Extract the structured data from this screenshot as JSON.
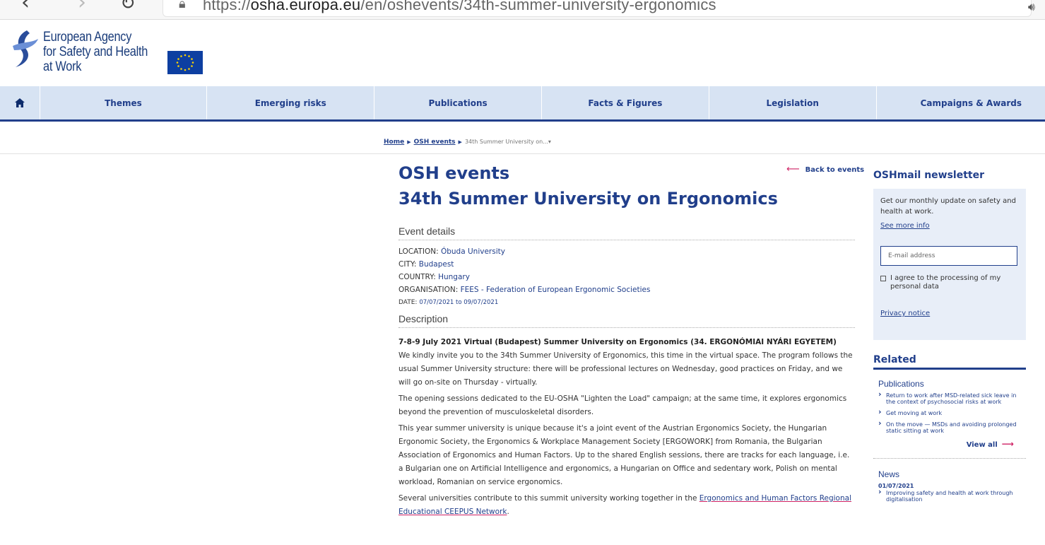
{
  "browser": {
    "back_icon": "‹",
    "forward_icon": "›",
    "reload_icon": "↻",
    "url_prefix": "https://",
    "url_domain": "osha.europa.eu",
    "url_path": "/en/oshevents/34th-summer-university-ergonomics"
  },
  "header": {
    "logo_line1": "European Agency",
    "logo_line2": "for Safety and Health",
    "logo_line3": "at Work"
  },
  "nav": {
    "items": [
      "Themes",
      "Emerging risks",
      "Publications",
      "Facts & Figures",
      "Legislation",
      "Campaigns & Awards"
    ]
  },
  "breadcrumb": {
    "home": "Home",
    "events": "OSH events",
    "current": "34th Summer University on...▾"
  },
  "main": {
    "back_label": "Back to events",
    "section": "OSH events",
    "title": "34th Summer University on Ergonomics",
    "details_heading": "Event details",
    "details": [
      {
        "label": "LOCATION: ",
        "value": "Óbuda University"
      },
      {
        "label": "CITY: ",
        "value": "Budapest"
      },
      {
        "label": "COUNTRY: ",
        "value": "Hungary"
      },
      {
        "label": "ORGANISATION: ",
        "value": "FEES - Federation of European Ergonomic Societies"
      },
      {
        "label": "DATE: ",
        "value": "07/07/2021 to 09/07/2021"
      }
    ],
    "description_heading": "Description",
    "desc_title": "7-8-9 July 2021 Virtual (Budapest) Summer University on Ergonomics (34. ERGONÓMIAI NYÁRI EGYETEM)",
    "paragraphs": [
      "We kindly invite you to the 34th Summer University of Ergonomics, this time in the virtual space. The program follows the usual Summer University structure: there will be professional lectures on Wednesday, good practices on Friday, and we will go on-site on Thursday - virtually.",
      "The opening sessions dedicated to the EU-OSHA \"Lighten the Load\" campaign; at the same time, it explores ergonomics beyond the prevention of musculoskeletal disorders.",
      "This year summer university is unique because it's a joint event of the Austrian Ergonomics Society, the Hungarian Ergonomic Society, the Ergonomics & Workplace Management Society [ERGOWORK] from Romania, the Bulgarian Association of Ergonomics and Human Factors. Up to the shared English sessions, there are tracks for each language, i.e. a Bulgarian one on Artificial Intelligence and ergonomics, a Hungarian on Office and sedentary work, Polish on mental workload, Romanian on service ergonomics."
    ],
    "last_para_prefix": "Several universities contribute to this summit university working together in the ",
    "last_para_link": "Ergonomics and Human Factors Regional Educational CEEPUS Network",
    "last_para_suffix": "."
  },
  "sidebar": {
    "newsletter_title": "OSHmail newsletter",
    "newsletter_text": "Get our monthly update on safety and health at work.",
    "see_more": "See more info",
    "email_placeholder": "E-mail address",
    "agree_label": "I agree to the processing of my personal data",
    "privacy": "Privacy notice",
    "related_title": "Related",
    "publications_heading": "Publications",
    "publications": [
      "Return to work after MSD-related sick leave in the context of psychosocial risks at work",
      "Get moving at work",
      "On the move — MSDs and avoiding prolonged static sitting at work"
    ],
    "view_all": "View all",
    "news_heading": "News",
    "news_date": "01/07/2021",
    "news_item": "Improving safety and health at work through digitalisation"
  }
}
